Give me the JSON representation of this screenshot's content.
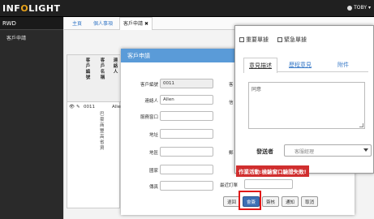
{
  "app": {
    "logo_pre": "INF",
    "logo_o": "O",
    "logo_post": "LIGHT",
    "user": "TOBY"
  },
  "sidebar": {
    "title": "RWD",
    "items": [
      {
        "label": "客戶申請"
      }
    ]
  },
  "tabs": [
    {
      "label": "主頁"
    },
    {
      "label": "個人事項"
    },
    {
      "label": "客戶申請"
    }
  ],
  "grid": {
    "headers": [
      "客戶編號",
      "客戶名稱",
      "連絡人"
    ],
    "row": {
      "id": "0011",
      "contact": "Allen"
    },
    "vertical_text": "巴豪商豐高省資"
  },
  "dialog_customer": {
    "title": "客戶申請",
    "fields": [
      {
        "label": "客戶編號",
        "value": "0011"
      },
      {
        "label": "連絡人",
        "value": "Allen"
      },
      {
        "label": "服務窗口",
        "value": ""
      },
      {
        "label": "地址",
        "value": ""
      },
      {
        "label": "地區",
        "value": ""
      },
      {
        "label": "國家",
        "value": ""
      },
      {
        "label": "傳真",
        "value": ""
      }
    ],
    "side_labels": [
      "客",
      "信",
      "郵",
      "最近訂單"
    ],
    "buttons": [
      "退回",
      "會簽",
      "簽核",
      "通知",
      "取消"
    ]
  },
  "dialog_approval": {
    "checkbox_important": "重要單據",
    "checkbox_urgent": "緊急單據",
    "tabs": [
      "意見描述",
      "歷程意見",
      "附件"
    ],
    "comment": "同意",
    "sender_label": "發送者",
    "sender_value": "客服經理",
    "error": "作業活動:檢驗窗口驗證失敗!"
  },
  "colors": {
    "accent": "#5a9bd8",
    "error": "#d02e2e",
    "highlight": "#e01818"
  }
}
